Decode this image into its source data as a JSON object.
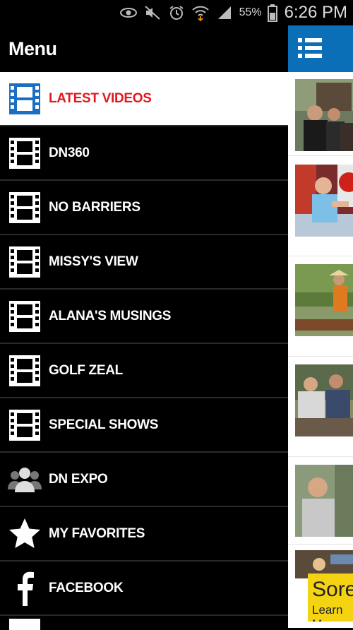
{
  "statusbar": {
    "battery_percent": "55%",
    "time": "6:26 PM",
    "icons": [
      "eye-icon",
      "mute-icon",
      "alarm-icon",
      "wifi-icon",
      "signal-icon",
      "battery-icon"
    ]
  },
  "menu": {
    "title": "Menu",
    "items": [
      {
        "label": "LATEST VIDEOS",
        "icon": "film-icon",
        "active": true
      },
      {
        "label": "DN360",
        "icon": "film-icon"
      },
      {
        "label": "NO BARRIERS",
        "icon": "film-icon"
      },
      {
        "label": "MISSY'S VIEW",
        "icon": "film-icon"
      },
      {
        "label": "ALANA'S MUSINGS",
        "icon": "film-icon"
      },
      {
        "label": "GOLF ZEAL",
        "icon": "film-icon"
      },
      {
        "label": "SPECIAL SHOWS",
        "icon": "film-icon"
      },
      {
        "label": "DN EXPO",
        "icon": "people-icon"
      },
      {
        "label": "MY FAVORITES",
        "icon": "star-icon"
      },
      {
        "label": "FACEBOOK",
        "icon": "facebook-icon"
      }
    ]
  },
  "content": {
    "header_icon": "list-icon",
    "thumbnails": [
      "video-thumbnail-1",
      "video-thumbnail-2",
      "video-thumbnail-3",
      "video-thumbnail-4",
      "video-thumbnail-5",
      "video-thumbnail-6"
    ],
    "ad": {
      "line1": "Sore",
      "line2": "Learn M"
    }
  },
  "colors": {
    "accent": "#0b6fb8",
    "active_text": "#e1181f",
    "ad_bg": "#f4d412"
  }
}
